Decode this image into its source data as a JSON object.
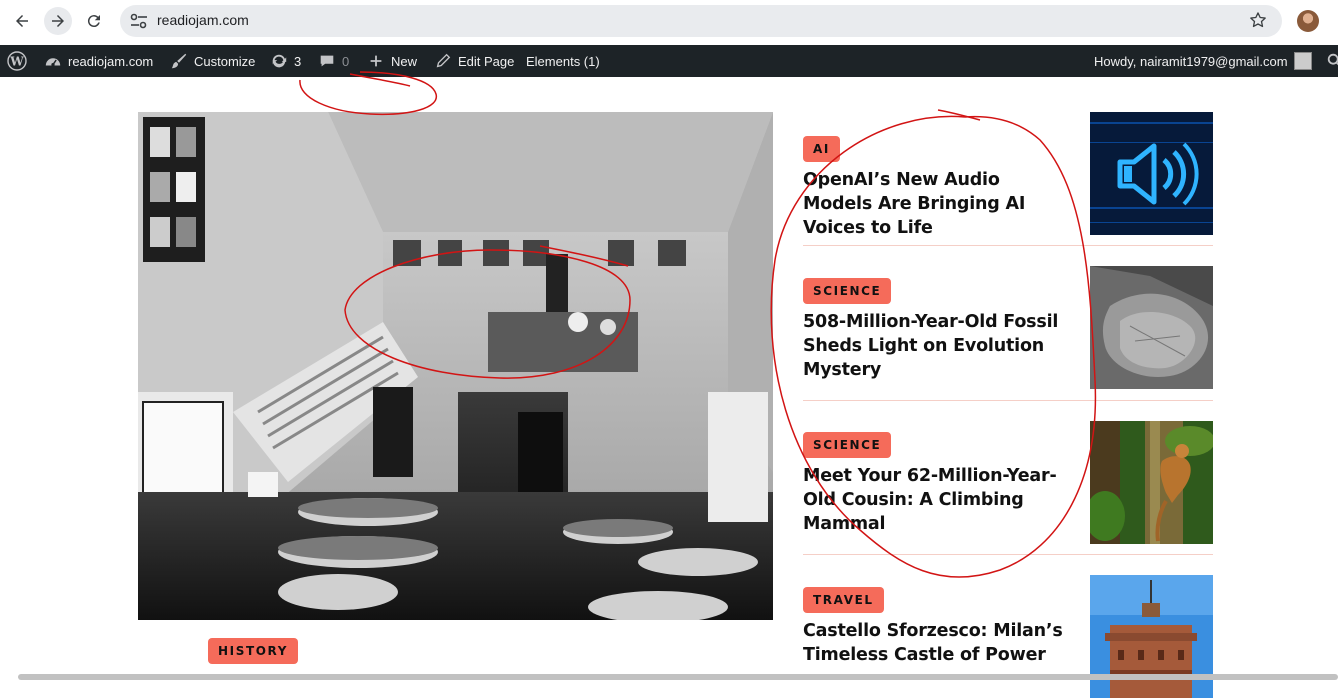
{
  "browser": {
    "url": "readiojam.com",
    "back_icon": "back-arrow-icon",
    "forward_icon": "forward-arrow-icon",
    "reload_icon": "reload-icon",
    "site_settings_icon": "tune-icon",
    "bookmark_icon": "star-icon"
  },
  "adminbar": {
    "site_name": "readiojam.com",
    "customize": "Customize",
    "updates_count": "3",
    "comments_count": "0",
    "new_label": "New",
    "edit_page": "Edit Page",
    "elements": "Elements (1)",
    "howdy": "Howdy, nairamit1979@gmail.com"
  },
  "featured": {
    "category": "HISTORY"
  },
  "articles": [
    {
      "category": "AI",
      "title": "OpenAI’s New Audio Models Are Bringing AI Voices to Life"
    },
    {
      "category": "SCIENCE",
      "title": "508-Million-Year-Old Fossil Sheds Light on Evolution Mystery"
    },
    {
      "category": "SCIENCE",
      "title": "Meet Your 62-Million-Year-Old Cousin: A Climbing Mammal"
    },
    {
      "category": "TRAVEL",
      "title": "Castello Sforzesco: Milan’s Timeless Castle of Power"
    }
  ],
  "colors": {
    "accent": "#f56b5a",
    "adminbar": "#1d2327",
    "annotation": "#d21414"
  }
}
